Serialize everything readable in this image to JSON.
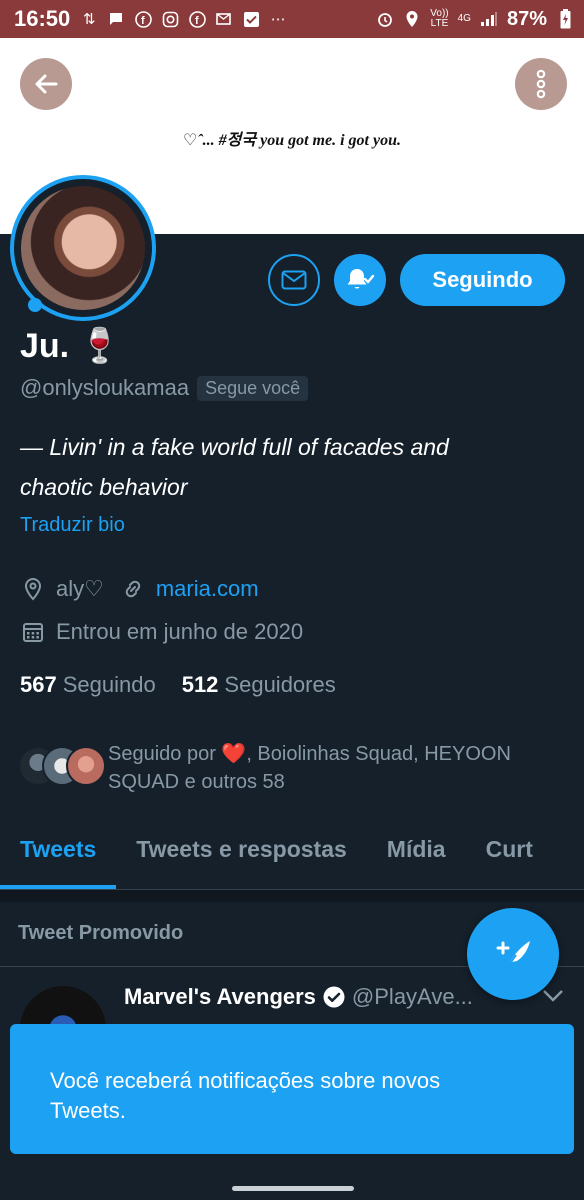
{
  "status_bar": {
    "time": "16:50",
    "network_label_top": "Vo))",
    "network_label_bottom": "LTE",
    "signal_label": "4G",
    "battery": "87%"
  },
  "banner": {
    "text": "♡ˆ... #정국 you got me. i got you."
  },
  "actions": {
    "follow_label": "Seguindo"
  },
  "profile": {
    "name": "Ju. 🍷",
    "handle": "@onlysloukamaa",
    "follows_you": "Segue você",
    "bio_line1": "— Livin' in a fake world full of facades and",
    "bio_line2": "chaotic behavior",
    "translate": "Traduzir bio",
    "location": "aly♡",
    "website": "maria.com",
    "joined": "Entrou em junho de 2020",
    "following_count": "567",
    "following_label": "Seguindo",
    "followers_count": "512",
    "followers_label": "Seguidores",
    "followed_by_line1": "Seguido por ❤️, Boiolinhas Squad, HEYOON",
    "followed_by_line2": "SQUAD e outros 58"
  },
  "tabs": [
    {
      "label": "Tweets"
    },
    {
      "label": "Tweets e respostas"
    },
    {
      "label": "Mídia"
    },
    {
      "label": "Curt"
    }
  ],
  "feed": {
    "promoted_label": "Tweet Promovido",
    "tweet_name": "Marvel's Avengers",
    "tweet_handle": "@PlayAve..."
  },
  "toast": {
    "line1": "Você receberá notificações sobre novos",
    "line2": "Tweets."
  },
  "colors": {
    "accent": "#1da1f2",
    "background": "#15202b",
    "status_bar": "#8a3a3a"
  }
}
